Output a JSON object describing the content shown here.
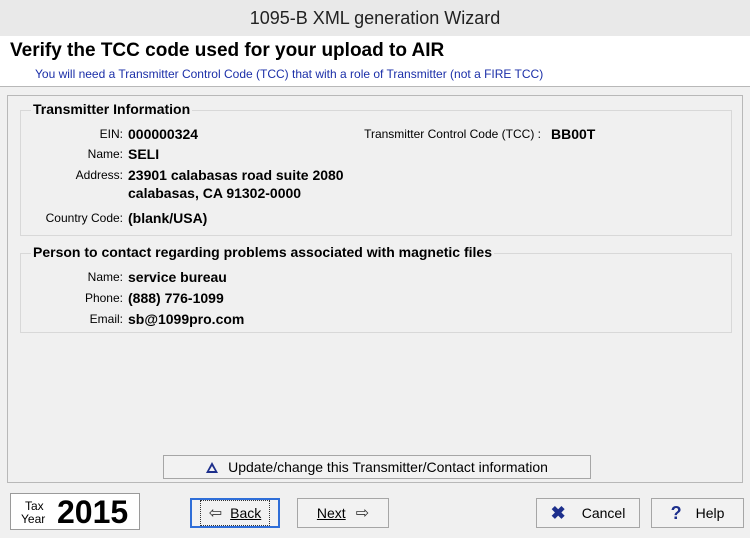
{
  "window": {
    "title": "1095-B XML generation  Wizard"
  },
  "header": {
    "title": "Verify the TCC code used for your upload to AIR",
    "subtitle": "You will need a Transmitter Control Code (TCC) that with a role of Transmitter (not a FIRE TCC)"
  },
  "transmitter": {
    "group_title": "Transmitter Information",
    "ein_label": "EIN:",
    "ein": "000000324",
    "tcc_label": "Transmitter Control Code (TCC) :",
    "tcc": "BB00T",
    "name_label": "Name:",
    "name": "SELI",
    "address_label": "Address:",
    "address_line1": "23901 calabasas road suite 2080",
    "address_line2": "calabasas, CA 91302-0000",
    "country_label": "Country Code:",
    "country": "(blank/USA)"
  },
  "contact": {
    "group_title": "Person to contact regarding problems associated with magnetic files",
    "name_label": "Name:",
    "name": "service bureau",
    "phone_label": "Phone:",
    "phone": "(888) 776-1099",
    "email_label": "Email:",
    "email": "sb@1099pro.com"
  },
  "update_button": {
    "label": "Update/change this Transmitter/Contact information",
    "icon": "triangle-up-icon"
  },
  "tax_year": {
    "tax_label": "Tax",
    "year_label": "Year",
    "value": "2015"
  },
  "buttons": {
    "back": "Back",
    "next": "Next",
    "cancel": "Cancel",
    "help": "Help"
  },
  "colors": {
    "accent": "#1d2f8c",
    "subtitle": "#1b2fa8",
    "focus": "#2f6ed8"
  }
}
